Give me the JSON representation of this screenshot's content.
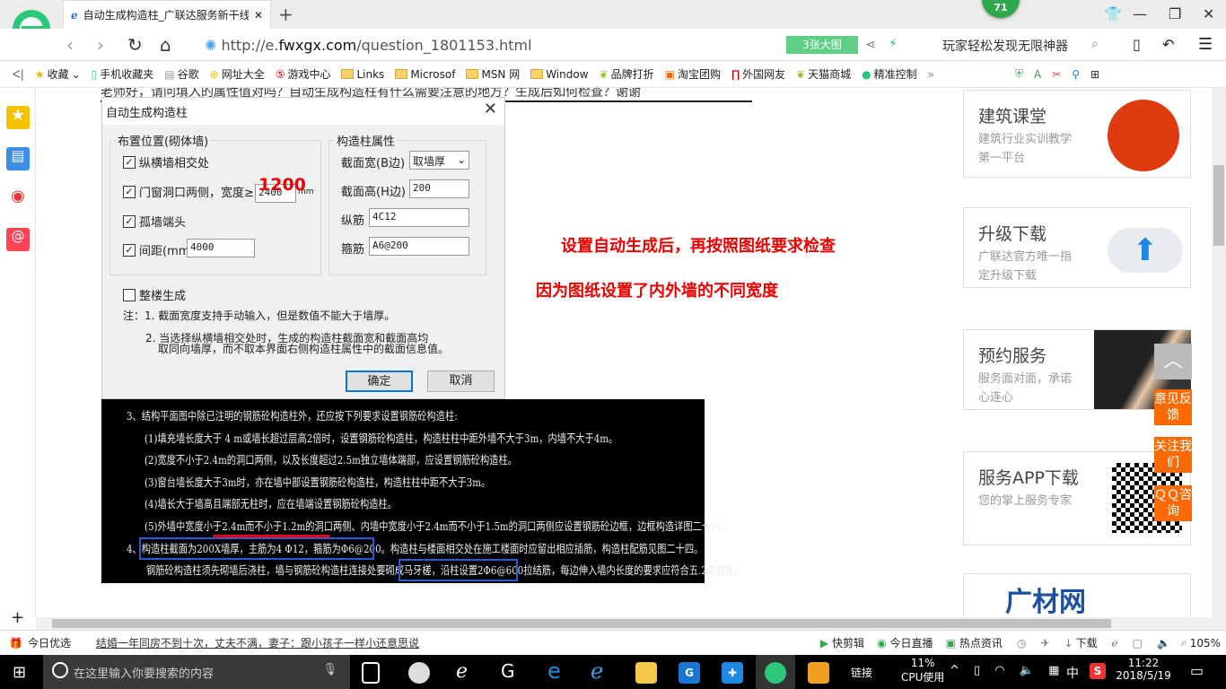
{
  "browser": {
    "tab_title": "自动生成构造柱_广联达服务新干线",
    "url_prefix": "http://e.",
    "url_host": "fwxgx.com",
    "url_path": "/question_1801153.html",
    "badge_count": "71",
    "big_pic_label": "3张大图",
    "search_hint": "玩家轻松发现无限神器",
    "bookmarks": [
      "收藏",
      "手机收藏夹",
      "谷歌",
      "网址大全",
      "游戏中心",
      "Links",
      "Microsof",
      "MSN 网",
      "Window",
      "品牌打折",
      "淘宝团购",
      "外国网友",
      "天猫商城",
      "精准控制"
    ]
  },
  "question_text": "老师好，请问填入的属性值对吗？自动生成构造柱有什么需要注意的地方？生成后如何检查？谢谢",
  "dialog": {
    "title": "自动生成构造柱",
    "group_left": "布置位置(砌体墙)",
    "group_right": "构造柱属性",
    "chk_cross": "纵横墙相交处",
    "chk_opening": "门窗洞口两侧，宽度≥",
    "opening_width": "2400",
    "unit_mm": "mm",
    "annotation": "1200",
    "chk_end": "孤墙端头",
    "chk_spacing": "间距(mm)",
    "spacing": "4000",
    "width_label": "截面宽(B边)",
    "width_value": "取墙厚",
    "height_label": "截面高(H边)",
    "height_value": "200",
    "long_bar_label": "纵筋",
    "long_bar": "4C12",
    "stirrup_label": "箍筋",
    "stirrup": "A6@200",
    "chk_whole": "整楼生成",
    "note1": "注：1. 截面宽度支持手动输入，但是数值不能大于墙厚。",
    "note2a": "2. 当选择纵横墙相交处时，生成的构造柱截面宽和截面高均",
    "note2b": "取同向墙厚，而不取本界面右侧构造柱属性中的截面信息值。",
    "ok": "确定",
    "cancel": "取消"
  },
  "cad_lines": [
    "3、结构平面图中除已注明的钢筋砼构造柱外，还应按下列要求设置钢筋砼构造柱:",
    "(1)填充墙长度大于 4  m或墙长超过层高2倍时，设置钢筋砼构造柱，构造柱柱中距外墙不大于3m，内墙不大于4m。",
    "(2)宽度不小于2.4m的洞口两侧，以及长度超过2.5m独立墙体端部，应设置钢筋砼构造柱。",
    "(3)窗台墙长度大于3m时，亦在墙中部设置钢筋砼构造柱，构造柱柱中距不大于3m。",
    "(4)墙长大于墙高且端部无柱时，应在墙端设置钢筋砼构造柱。",
    "(5)外墙中宽度小于2.4m而不小于1.2m的洞口两侧、内墙中宽度小于2.4m而不小于1.5m的洞口两侧应设置钢筋砼边框，边框构造详图二十六。",
    "4、构造柱截面为200X墙厚，主筋为4 Φ12，箍筋为Φ6@200。构造柱与楼面相交处在施工楼面时应留出相应插筋，构造柱配筋见图二十四。",
    "钢筋砼构造柱须先砌墙后浇柱，墙与钢筋砼构造柱连接处要砌成马牙槎，沿柱设置2Φ6@600拉结筋，每边伸入墙内长度的要求应符合五.2条规定。"
  ],
  "annotations": [
    "设置自动生成后，再按照图纸要求检查",
    "因为图纸设置了内外墙的不同宽度"
  ],
  "sidebar_cards": [
    {
      "title": "建筑课堂",
      "desc": "建筑行业实训教学第一平台"
    },
    {
      "title": "升级下载",
      "desc": "广联达官方唯一指定升级下载"
    },
    {
      "title": "预约服务",
      "desc": "服务面对面，承诺心连心"
    },
    {
      "title": "服务APP下载",
      "desc": "您的掌上服务专家"
    }
  ],
  "ad_logo": "广材网",
  "float_buttons": [
    "意见反馈",
    "关注我们",
    "ＱＱ咨询"
  ],
  "status": {
    "today": "今日优选",
    "news": "结婚一年同房不到十次，丈夫不满，妻子：跟小孩子一样小还意思说",
    "quick_cut": "快剪辑",
    "live": "今日直播",
    "hot": "热点资讯",
    "download": "下载",
    "zoom": "105%"
  },
  "taskbar": {
    "search_placeholder": "在这里输入你要搜索的内容",
    "link": "链接",
    "cpu_pct": "11%",
    "cpu_label": "CPU使用",
    "ime": "中",
    "time": "11:22",
    "date": "2018/5/19"
  },
  "colors": {
    "accent_green": "#2ea84a",
    "annotation_red": "#e00000",
    "float_orange": "#ff6a00",
    "highlight_blue": "#2a5bd7"
  }
}
